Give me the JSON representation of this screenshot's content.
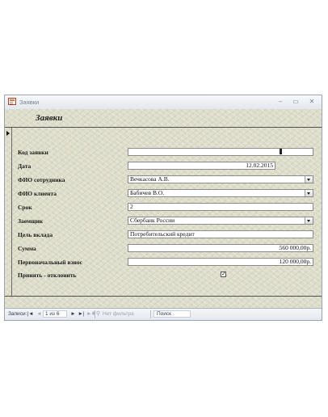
{
  "window": {
    "title": "Заявки",
    "minimize_glyph": "–",
    "maximize_glyph": "▭",
    "close_glyph": "✕"
  },
  "form": {
    "title": "Заявки",
    "fields": [
      {
        "label": "Код заявки",
        "value": ""
      },
      {
        "label": "Дата",
        "value": "12.02.2015"
      },
      {
        "label": "ФИО сотрудника",
        "value": "Вечкасова А.В."
      },
      {
        "label": "ФИО клиента",
        "value": "Бабичев В.О."
      },
      {
        "label": "Срок",
        "value": "2"
      },
      {
        "label": "Заемщик",
        "value": "Сбербанк России"
      },
      {
        "label": "Цель вклада",
        "value": "Потребительский кредит"
      },
      {
        "label": "Сумма",
        "value": "560 000,00р."
      },
      {
        "label": "Первоначальный взнос",
        "value": "120 000,00р."
      },
      {
        "label": "Принять - отклонить",
        "checked": true,
        "check_glyph": "✓"
      }
    ]
  },
  "navigator": {
    "records_label": "Записи:",
    "first": "|◄",
    "prev": "◄",
    "position": "1 из 6",
    "next": "►",
    "last": "►|",
    "new": "►✱",
    "filter_label": "Нет фильтра",
    "search_label": "Поиск"
  }
}
